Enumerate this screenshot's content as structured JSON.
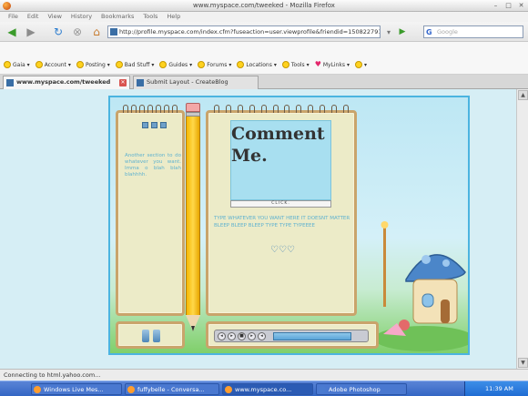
{
  "window": {
    "title": "www.myspace.com/tweeked - Mozilla Firefox"
  },
  "menubar": [
    "File",
    "Edit",
    "View",
    "History",
    "Bookmarks",
    "Tools",
    "Help"
  ],
  "nav": {
    "url": "http://profile.myspace.com/index.cfm?fuseaction=user.viewprofile&friendid=150822791&MyToken=e43",
    "search_placeholder": "Google"
  },
  "gaia": {
    "items": [
      {
        "label": "Gaia",
        "icon": "gaia-icon"
      },
      {
        "label": "Account",
        "icon": "smiley-icon"
      },
      {
        "label": "Posting",
        "icon": "smiley-icon"
      },
      {
        "label": "Bad Stuff",
        "icon": "smiley-icon"
      },
      {
        "label": "Guides",
        "icon": "smiley-icon"
      },
      {
        "label": "Forums",
        "icon": "smiley-icon"
      },
      {
        "label": "Locations",
        "icon": "smiley-icon"
      },
      {
        "label": "Tools",
        "icon": "smiley-icon"
      },
      {
        "label": "MyLinks",
        "icon": "heart-icon"
      }
    ]
  },
  "tabs": [
    {
      "label": "www.myspace.com/tweeked",
      "active": true
    },
    {
      "label": "Submit Layout - CreateBlog",
      "active": false
    }
  ],
  "page": {
    "left_text": "Another section to do whatever you want. Imma o blah blah blahhhh.",
    "comment_title": "Comment Me.",
    "click_label": "CLICK.",
    "type_text": "TYPE WHATEVER YOU WANT HERE IT DOESNT MATTER BLEEP BLEEP BLEEP TYPE TYPE TYPEEEE",
    "hearts": "♡♡♡"
  },
  "status": {
    "text": "Connecting to html.yahoo.com..."
  },
  "taskbar": {
    "tasks": [
      {
        "label": "Windows Live Mes..."
      },
      {
        "label": "fuffybelle - Conversa..."
      },
      {
        "label": "www.myspace.co..."
      },
      {
        "label": "Adobe Photoshop"
      }
    ],
    "clock": "11:39 AM"
  },
  "colors": {
    "accent": "#4bb4e0",
    "panel": "#ecebc8",
    "panel_border": "#c9a46b",
    "text_blue": "#5fb2cf"
  }
}
